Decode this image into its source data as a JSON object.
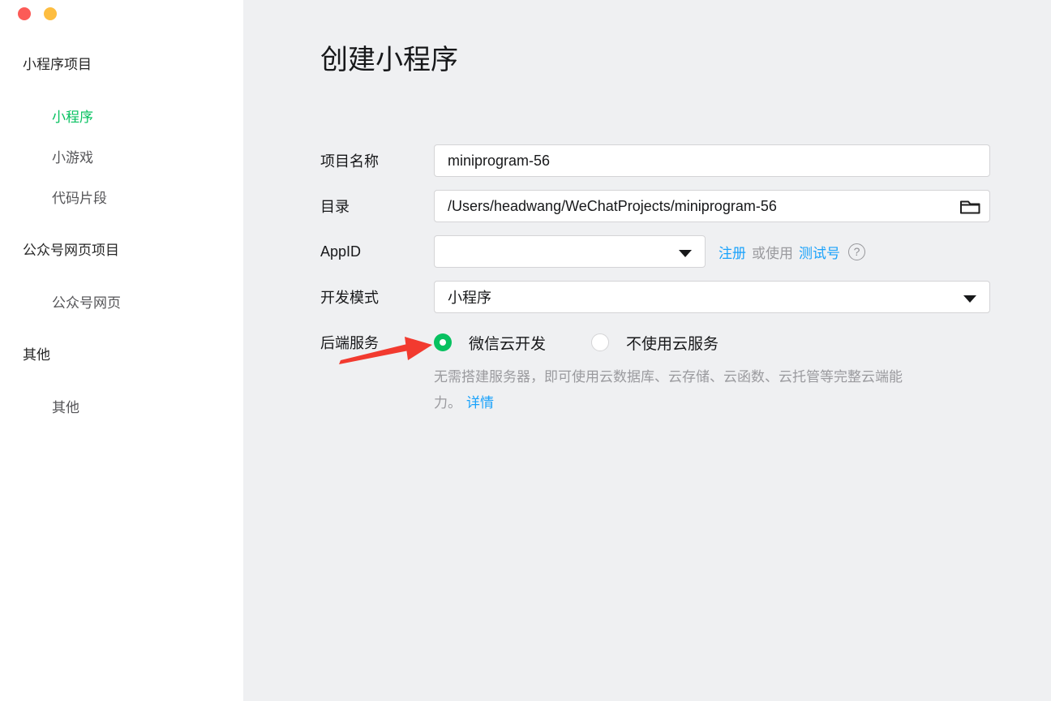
{
  "window": {
    "controls": {
      "close": "close",
      "minimize": "minimize"
    }
  },
  "sidebar": {
    "sections": [
      {
        "label": "小程序项目",
        "items": [
          {
            "label": "小程序",
            "active": true
          },
          {
            "label": "小游戏",
            "active": false
          },
          {
            "label": "代码片段",
            "active": false
          }
        ]
      },
      {
        "label": "公众号网页项目",
        "items": [
          {
            "label": "公众号网页",
            "active": false
          }
        ]
      },
      {
        "label": "其他",
        "items": [
          {
            "label": "其他",
            "active": false
          }
        ]
      }
    ]
  },
  "main": {
    "title": "创建小程序",
    "form": {
      "project_name": {
        "label": "项目名称",
        "value": "miniprogram-56"
      },
      "directory": {
        "label": "目录",
        "value": "/Users/headwang/WeChatProjects/miniprogram-56"
      },
      "appid": {
        "label": "AppID",
        "value": "",
        "links": {
          "register": "注册",
          "or_use": "或使用",
          "test_account": "测试号"
        },
        "help_icon": "?"
      },
      "dev_mode": {
        "label": "开发模式",
        "value": "小程序"
      },
      "backend": {
        "label": "后端服务",
        "options": [
          {
            "label": "微信云开发",
            "selected": true
          },
          {
            "label": "不使用云服务",
            "selected": false
          }
        ],
        "description_line1": "无需搭建服务器，即可使用云数据库、云存储、云函数、云托管等完整云端能",
        "description_line2": "力。",
        "detail_link": "详情"
      }
    }
  },
  "colors": {
    "accent_green": "#07c160",
    "link_blue": "#1aa2fb",
    "arrow_red": "#f23a2f",
    "traffic_red": "#fc5b57",
    "traffic_yellow": "#fdbd40",
    "main_bg": "#eff0f2"
  }
}
